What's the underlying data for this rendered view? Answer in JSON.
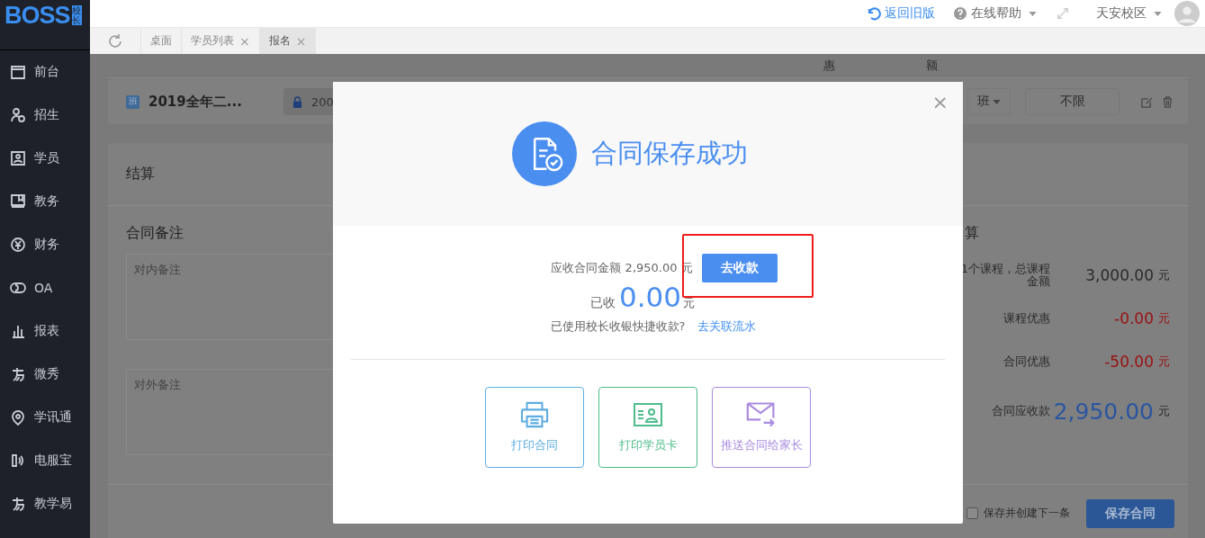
{
  "header": {
    "logo": "BOSS",
    "logo_badge": "校长",
    "links": [
      {
        "label": "返回旧版",
        "kind": "back"
      },
      {
        "label": "在线帮助",
        "kind": "help"
      }
    ],
    "campus": "天安校区"
  },
  "tabs": [
    {
      "label": "桌面",
      "selected": false
    },
    {
      "label": "学员列表",
      "close": "×",
      "selected": false
    },
    {
      "label": "报名",
      "close": "×",
      "selected": true
    }
  ],
  "sidebar": {
    "items": [
      {
        "label": "前台",
        "kind": "calendar"
      },
      {
        "label": "招生",
        "kind": "user-add"
      },
      {
        "label": "学员",
        "kind": "contact"
      },
      {
        "label": "教务",
        "kind": "book"
      },
      {
        "label": "财务",
        "kind": "yen"
      },
      {
        "label": "OA",
        "kind": "toggle"
      },
      {
        "label": "报表",
        "kind": "chart"
      },
      {
        "label": "微秀",
        "kind": "stroke"
      },
      {
        "label": "学讯通",
        "kind": "pin"
      },
      {
        "label": "电服宝",
        "kind": "phone"
      },
      {
        "label": "教学易",
        "kind": "stroke"
      }
    ]
  },
  "page": {
    "column_headers": [
      "惠",
      "额"
    ],
    "class_row": {
      "badge": "班",
      "name": "2019全年二...",
      "field_value": "200",
      "select": "班",
      "limit": "不限"
    },
    "settlement": {
      "title": "结算",
      "notes_title": "合同备注",
      "notes": [
        {
          "placeholder": "对内备注"
        },
        {
          "placeholder": "对外备注"
        }
      ],
      "summary_title": "算",
      "rows": [
        {
          "label": "1个课程，总课程金额",
          "amount": "3,000.00",
          "unit": "元",
          "kind": "normal"
        },
        {
          "label": "课程优惠",
          "amount": "-0.00",
          "unit": "元",
          "kind": "discount"
        },
        {
          "label": "合同优惠",
          "amount": "-50.00",
          "unit": "元",
          "kind": "discount"
        },
        {
          "label": "合同应收款",
          "amount": "2,950.00",
          "unit": "元",
          "kind": "total"
        }
      ],
      "save_next": {
        "label": "保存并创建下一条",
        "checked": false
      },
      "save_button": "保存合同"
    }
  },
  "dialog": {
    "title": "合同保存成功",
    "close": "×",
    "due_label": "应收合同金额 2,950.00",
    "due_unit": "元",
    "collect_button": "去收款",
    "highlight": true,
    "received_label": "已收",
    "received_amount": "0.00",
    "received_unit": "元",
    "hint": "已使用校长收银快捷收款?",
    "hint_link": "去关联流水",
    "actions": [
      {
        "label": "打印合同",
        "kind": "print",
        "color": "#5dade2"
      },
      {
        "label": "打印学员卡",
        "kind": "card",
        "color": "#4dbb8a"
      },
      {
        "label": "推送合同给家长",
        "kind": "send",
        "color": "#a98be0"
      }
    ]
  }
}
